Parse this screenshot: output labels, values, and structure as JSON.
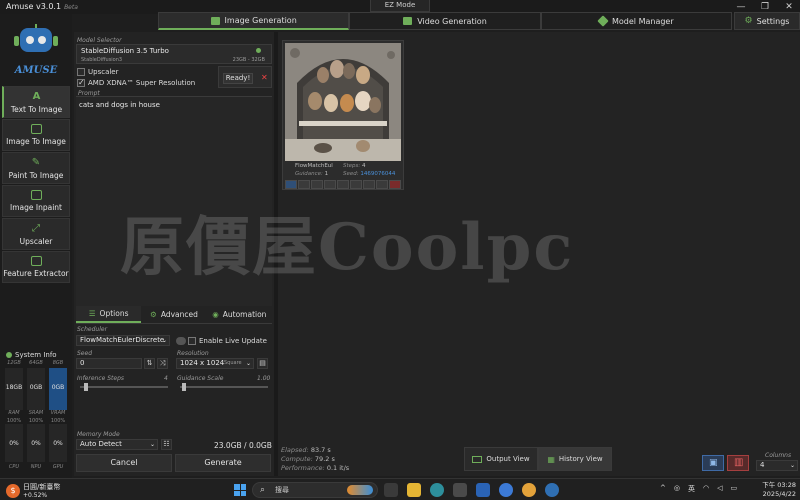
{
  "window": {
    "title": "Amuse v3.0.1",
    "title_tag": "Beta",
    "mode": "EZ Mode",
    "controls": [
      "—",
      "❐",
      "✕"
    ]
  },
  "tabs": [
    {
      "label": "Image Generation",
      "icon": "image-icon",
      "active": true
    },
    {
      "label": "Video Generation",
      "icon": "video-icon",
      "active": false
    },
    {
      "label": "Model Manager",
      "icon": "layers-icon",
      "active": false
    }
  ],
  "settings_label": "Settings",
  "sidebar": {
    "logo_text": "AMUSE",
    "items": [
      {
        "label": "Text To Image",
        "icon": "text-icon",
        "active": true
      },
      {
        "label": "Image To Image",
        "icon": "image-icon",
        "active": false
      },
      {
        "label": "Paint To Image",
        "icon": "brush-icon",
        "active": false
      },
      {
        "label": "Image Inpaint",
        "icon": "inpaint-icon",
        "active": false
      },
      {
        "label": "Upscaler",
        "icon": "expand-icon",
        "active": false
      },
      {
        "label": "Feature Extractor",
        "icon": "extract-icon",
        "active": false
      }
    ]
  },
  "system_info": {
    "title": "System Info",
    "columns": [
      {
        "top": "12GB",
        "value": "18GB",
        "label": "RAM",
        "pct": "100%",
        "util": "0%",
        "util_label": "CPU",
        "fill": 0.0
      },
      {
        "top": "64GB",
        "value": "0GB",
        "label": "SRAM",
        "pct": "100%",
        "util": "0%",
        "util_label": "NPU",
        "fill": 0.0
      },
      {
        "top": "8GB",
        "value": "0GB",
        "label": "VRAM",
        "pct": "100%",
        "util": "0%",
        "util_label": "GPU",
        "fill": 1.0
      }
    ]
  },
  "model": {
    "caption": "Model Selector",
    "name": "StableDiffusion 3.5 Turbo",
    "sub": "StableDiffusion3",
    "vram": "23GB - 32GB"
  },
  "upscaler_label": "Upscaler",
  "xdna_label": "AMD XDNA™ Super Resolution",
  "status": {
    "text": "Ready!",
    "close": "✕"
  },
  "prompt": {
    "caption": "Prompt",
    "text": "cats and dogs in house"
  },
  "options_tabs": [
    {
      "label": "Options",
      "active": true
    },
    {
      "label": "Advanced",
      "active": false
    },
    {
      "label": "Automation",
      "active": false
    }
  ],
  "options": {
    "scheduler_caption": "Scheduler",
    "scheduler": "FlowMatchEulerDiscrete",
    "live_update": "Enable Live Update",
    "seed_caption": "Seed",
    "seed": "0",
    "resolution_caption": "Resolution",
    "resolution": "1024 x 1024",
    "resolution_mode": "Square",
    "steps_caption": "Inference Steps",
    "steps_value": "4",
    "steps_fill": 0.05,
    "guidance_caption": "Guidance Scale",
    "guidance_value": "1.00",
    "guidance_fill": 0.02,
    "memory_caption": "Memory Mode",
    "memory": "Auto Detect",
    "memory_usage": "23.0GB / 0.0GB"
  },
  "buttons": {
    "cancel": "Cancel",
    "generate": "Generate"
  },
  "result": {
    "scheduler_short": "FlowMatchEul",
    "steps_k": "Steps:",
    "steps_v": "4",
    "guidance_k": "Guidance:",
    "guidance_v": "1",
    "seed_k": "Seed:",
    "seed_v": "1469076044"
  },
  "stats": {
    "elapsed_k": "Elapsed:",
    "elapsed_v": "83.7 s",
    "compute_k": "Compute:",
    "compute_v": "79.2 s",
    "perf_k": "Performance:",
    "perf_v": "0.1 it/s"
  },
  "views": {
    "output": "Output View",
    "history": "History View"
  },
  "columns": {
    "caption": "Columns",
    "value": "4"
  },
  "watermark": "原價屋Coolpc",
  "taskbar": {
    "stock_name": "日圓/新臺幣",
    "stock_pct": "+0.52%",
    "search": "搜尋",
    "tray_lang": "英",
    "time": "下午 03:28",
    "date": "2025/4/22"
  }
}
